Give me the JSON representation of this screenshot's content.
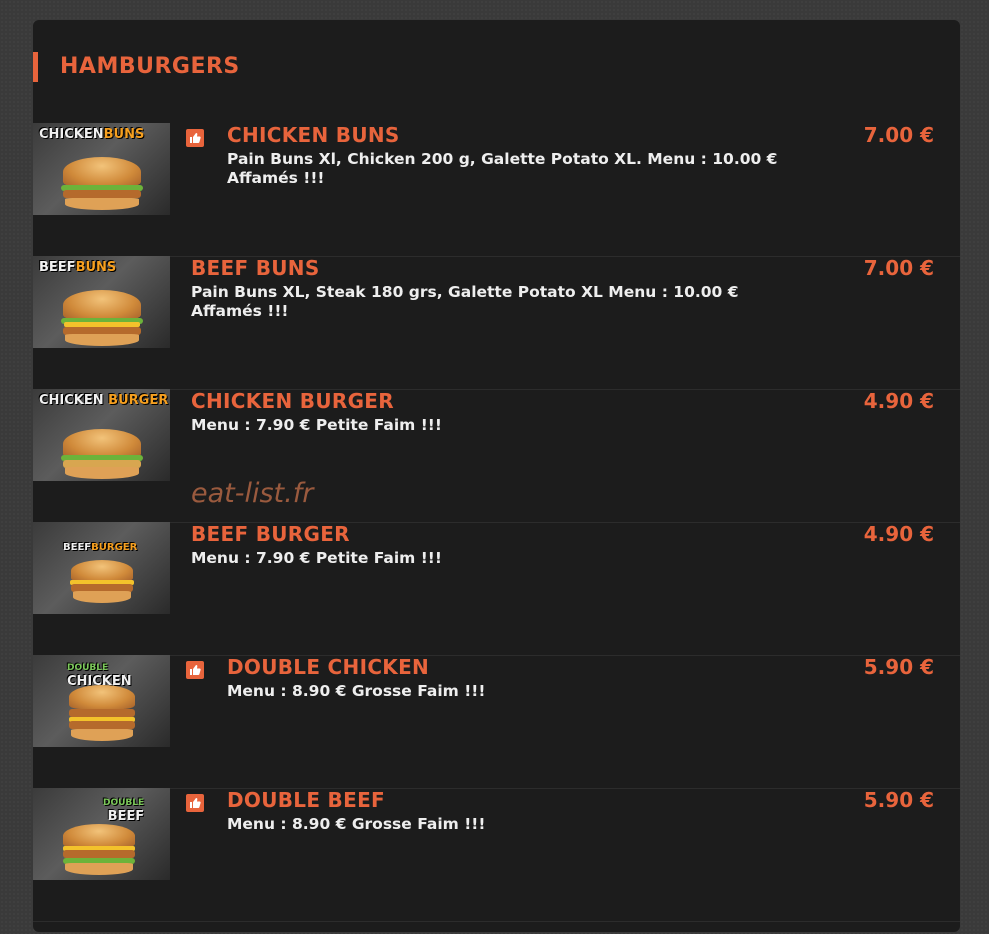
{
  "section": {
    "title": "HAMBURGERS"
  },
  "watermark": "eat-list.fr",
  "items": [
    {
      "name": "CHICKEN BUNS",
      "description": "Pain Buns Xl, Chicken 200 g, Galette Potato XL. Menu : 10.00 € Affamés !!!",
      "price": "7.00 €",
      "liked": true,
      "thumb_label_main": "CHICKEN",
      "thumb_label_accent": "BUNS"
    },
    {
      "name": "BEEF BUNS",
      "description": "Pain Buns XL, Steak 180 grs, Galette Potato XL Menu : 10.00 € Affamés !!!",
      "price": "7.00 €",
      "liked": false,
      "thumb_label_main": "BEEF",
      "thumb_label_accent": "BUNS"
    },
    {
      "name": "CHICKEN BURGER",
      "description": "Menu : 7.90 € Petite Faim !!!",
      "price": "4.90 €",
      "liked": false,
      "thumb_label_main": "CHICKEN",
      "thumb_label_accent": "BURGER"
    },
    {
      "name": "BEEF BURGER",
      "description": "Menu : 7.90 € Petite Faim !!!",
      "price": "4.90 €",
      "liked": false,
      "thumb_label_main": "BEEF",
      "thumb_label_accent": "BURGER"
    },
    {
      "name": "DOUBLE CHICKEN",
      "description": "Menu : 8.90 € Grosse Faim !!!",
      "price": "5.90 €",
      "liked": true,
      "thumb_label_main": "CHICKEN",
      "thumb_label_accent": "DOUBLE"
    },
    {
      "name": "DOUBLE BEEF",
      "description": "Menu : 8.90 € Grosse Faim !!!",
      "price": "5.90 €",
      "liked": true,
      "thumb_label_main": "BEEF",
      "thumb_label_accent": "DOUBLE"
    }
  ],
  "colors": {
    "accent": "#e8643c",
    "panel": "#1c1c1c",
    "text": "#eeeeee"
  },
  "icons": {
    "like": "thumbs-up-icon"
  }
}
